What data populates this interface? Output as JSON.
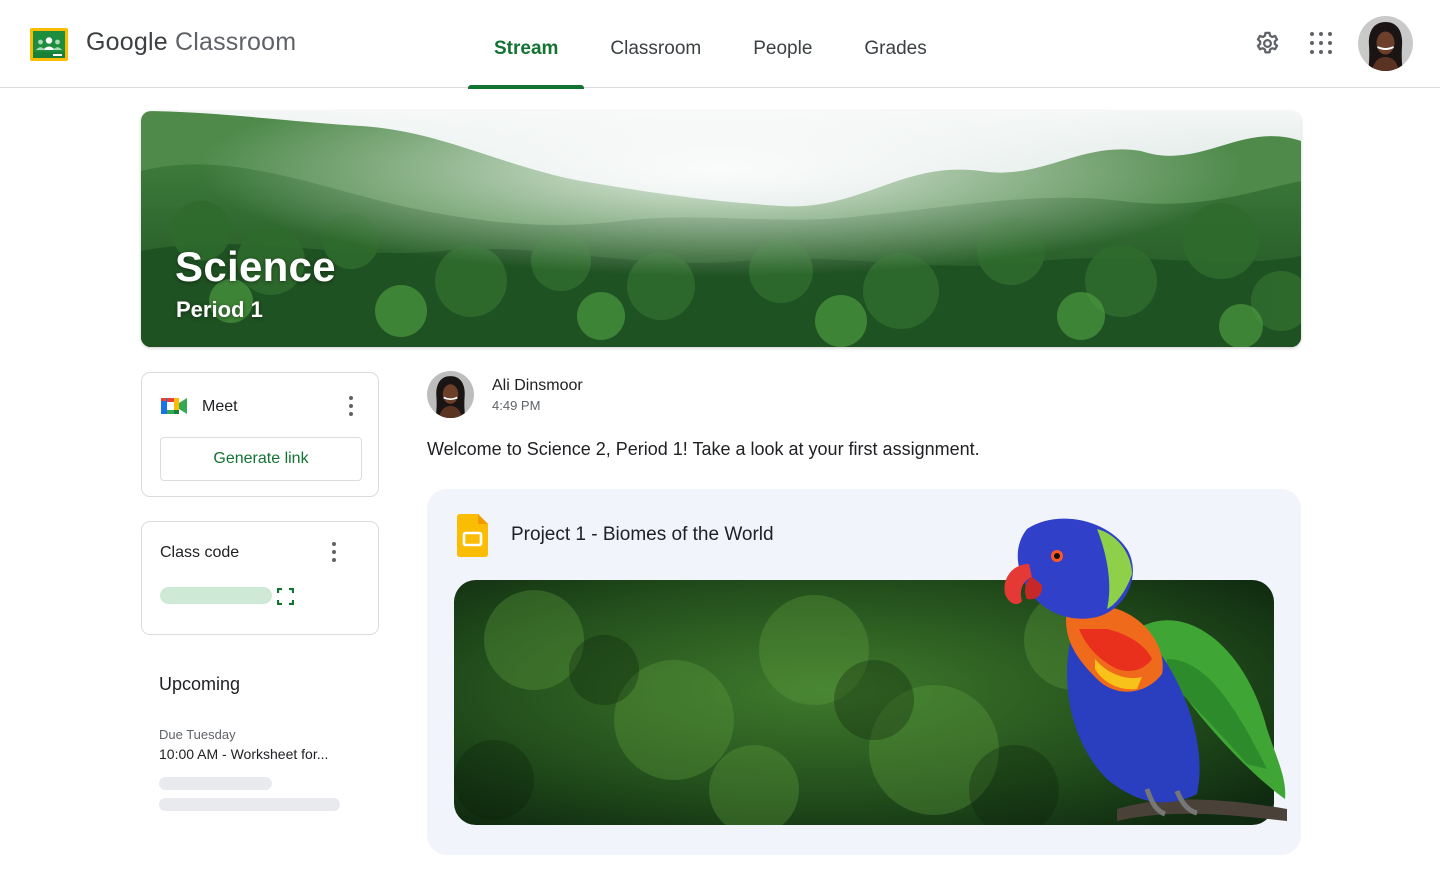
{
  "app": {
    "name_part1": "Google",
    "name_part2": "Classroom"
  },
  "tabs": [
    {
      "label": "Stream",
      "active": true
    },
    {
      "label": "Classroom",
      "active": false
    },
    {
      "label": "People",
      "active": false
    },
    {
      "label": "Grades",
      "active": false
    }
  ],
  "header_icons": [
    "settings-gear-icon",
    "apps-grid-icon",
    "account-avatar"
  ],
  "course": {
    "title": "Science",
    "period": "Period 1"
  },
  "meet": {
    "label": "Meet",
    "button_label": "Generate link",
    "icon": "google-meet-icon"
  },
  "class_code": {
    "label": "Class code",
    "icon": "fullscreen-icon"
  },
  "upcoming": {
    "title": "Upcoming",
    "due_day": "Due Tuesday",
    "item": "10:00 AM - Worksheet for..."
  },
  "post": {
    "author": "Ali Dinsmoor",
    "time": "4:49 PM",
    "text": "Welcome to Science 2, Period 1! Take a look at your first assignment."
  },
  "attachment": {
    "title": "Project 1 - Biomes of the World",
    "icon": "google-slides-icon"
  },
  "colors": {
    "accent": "#137333",
    "code_pill": "#ceead6",
    "attachment_bg": "#f1f4fb",
    "slides_yellow": "#fbbc04"
  }
}
